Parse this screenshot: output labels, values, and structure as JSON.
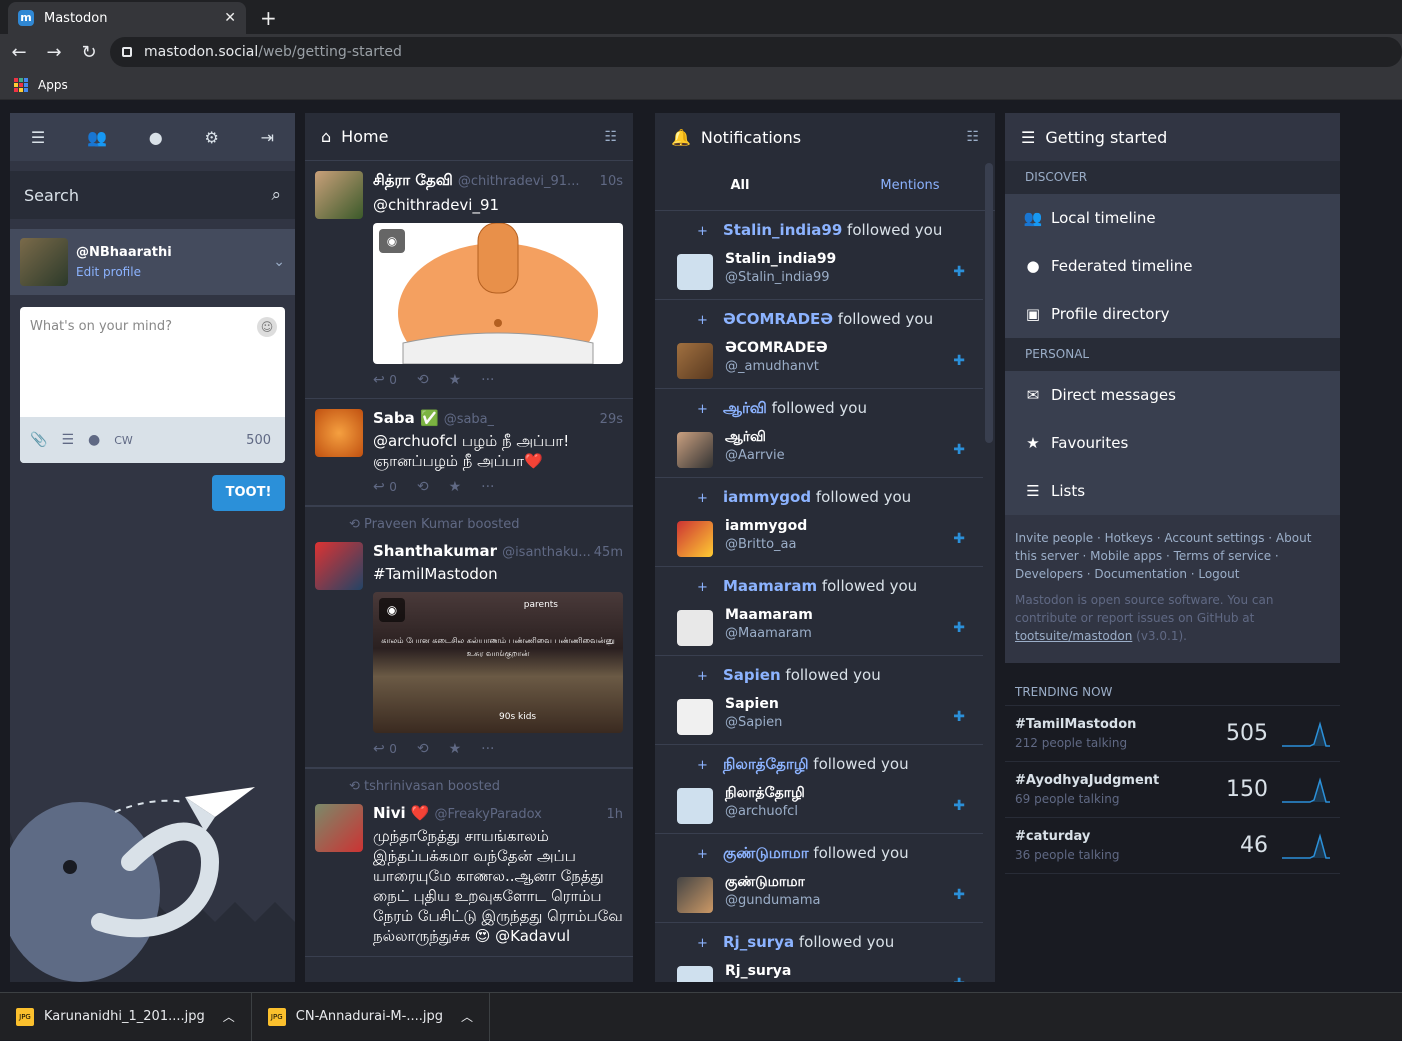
{
  "browser": {
    "tab_title": "Mastodon",
    "url_host": "mastodon.social",
    "url_path": "/web/getting-started",
    "bookmark_apps": "Apps"
  },
  "compose": {
    "search_placeholder": "Search",
    "account_name": "@NBhaarathi",
    "edit_profile": "Edit profile",
    "textarea_placeholder": "What's on your mind?",
    "cw": "CW",
    "char_count": "500",
    "toot_button": "TOOT!"
  },
  "home": {
    "title": "Home",
    "statuses": [
      {
        "display_name": "சித்ரா தேவி",
        "username": "@chithradevi_91...",
        "time": "10s",
        "text": "@chithradevi_91",
        "replies": "0"
      },
      {
        "display_name": "Saba ✅",
        "username": "@saba_",
        "time": "29s",
        "text": "@archuofcl பழம் நீ அப்பா! ஞானப்பழம் நீ அப்பா❤️",
        "replies": "0"
      },
      {
        "boosted_by": "Praveen Kumar boosted",
        "display_name": "Shanthakumar",
        "username": "@isanthaku...",
        "time": "45m",
        "text": "#TamilMastodon",
        "replies": "0",
        "media_top": "parents",
        "media_caption": "காலம் போன கடைசில கல்யாணம் பண்ணிவை பண்ணிவைன்னு உசுர வாங்குறான்",
        "media_bottom": "90s kids"
      },
      {
        "boosted_by": "tshrinivasan boosted",
        "display_name": "Nivi ❤️",
        "username": "@FreakyParadox",
        "time": "1h",
        "text": "முந்தாநேத்து சாயங்காலம் இந்தப்பக்கமா வந்தேன் அப்ப யாரையுமே காணல..ஆனா நேத்து நைட் புதிய உறவுகளோட ரொம்ப நேரம் பேசிட்டு இருந்தது ரொம்பவே நல்லாருந்துச்சு 😍 @Kadavul"
      }
    ]
  },
  "notifications": {
    "title": "Notifications",
    "tab_all": "All",
    "tab_mentions": "Mentions",
    "items": [
      {
        "actor": "Stalin_india99",
        "verb": " followed you",
        "name": "Stalin_india99",
        "handle": "@Stalin_india99"
      },
      {
        "actor": "ƏCOMRADEƏ",
        "verb": " followed you",
        "name": "ƏCOMRADEƏ",
        "handle": "@_amudhanvt"
      },
      {
        "actor": "ஆர்வி",
        "verb": " followed you",
        "name": "ஆர்வி",
        "handle": "@Aarrvie"
      },
      {
        "actor": "iammygod",
        "verb": " followed you",
        "name": "iammygod",
        "handle": "@Britto_aa"
      },
      {
        "actor": "Maamaram",
        "verb": " followed you",
        "name": "Maamaram",
        "handle": "@Maamaram"
      },
      {
        "actor": "Sapien",
        "verb": " followed you",
        "name": "Sapien",
        "handle": "@Sapien"
      },
      {
        "actor": "நிலாத்தோழி",
        "verb": " followed you",
        "name": "நிலாத்தோழி",
        "handle": "@archuofcl"
      },
      {
        "actor": "குண்டுமாமா",
        "verb": " followed you",
        "name": "குண்டுமாமா",
        "handle": "@gundumama"
      },
      {
        "actor": "Rj_surya",
        "verb": " followed you",
        "name": "Rj_surya",
        "handle": ""
      }
    ]
  },
  "getting_started": {
    "title": "Getting started",
    "discover": "DISCOVER",
    "local": "Local timeline",
    "federated": "Federated timeline",
    "directory": "Profile directory",
    "personal": "PERSONAL",
    "dm": "Direct messages",
    "favourites": "Favourites",
    "lists": "Lists",
    "links": "Invite people · Hotkeys · Account settings · About this server · Mobile apps · Terms of service · Developers · Documentation · Logout",
    "footer_text": "Mastodon is open source software. You can contribute or report issues on GitHub at ",
    "footer_link": "tootsuite/mastodon",
    "footer_version": " (v3.0.1).",
    "trending_title": "TRENDING NOW",
    "trends": [
      {
        "tag": "#TamilMastodon",
        "talking": "212 people talking",
        "count": "505"
      },
      {
        "tag": "#AyodhyaJudgment",
        "talking": "69 people talking",
        "count": "150"
      },
      {
        "tag": "#caturday",
        "talking": "36 people talking",
        "count": "46"
      }
    ]
  },
  "downloads": [
    {
      "file": "Karunanidhi_1_201....jpg"
    },
    {
      "file": "CN-Annadurai-M-....jpg"
    }
  ],
  "colors": {
    "accent": "#2b90d9",
    "link": "#8cb3ff",
    "bg": "#191b22",
    "panel": "#282c37"
  }
}
